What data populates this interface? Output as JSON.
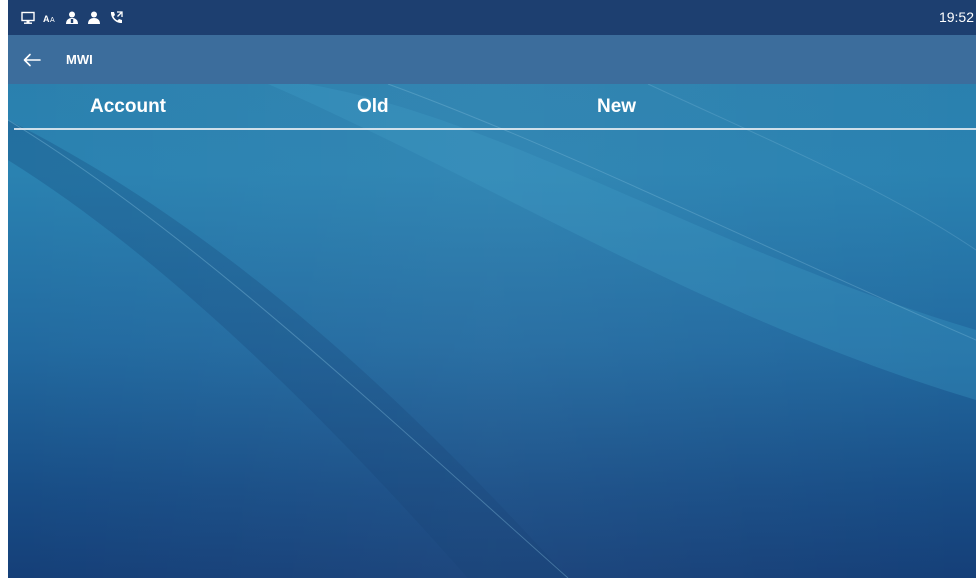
{
  "status_bar": {
    "icons": [
      "display-icon",
      "text-size-icon",
      "contacts-icon",
      "user-icon",
      "call-forward-icon"
    ],
    "time": "19:52"
  },
  "title_bar": {
    "back_icon": "back-arrow-icon",
    "title": "MWI"
  },
  "table": {
    "columns": [
      "Account",
      "Old",
      "New"
    ],
    "rows": []
  },
  "colors": {
    "status_bar_bg": "#1d3f70",
    "title_bar_bg": "#3c6d9c",
    "wallpaper_top": "#2b7fac",
    "wallpaper_bottom": "#153f78",
    "text": "#ffffff"
  }
}
